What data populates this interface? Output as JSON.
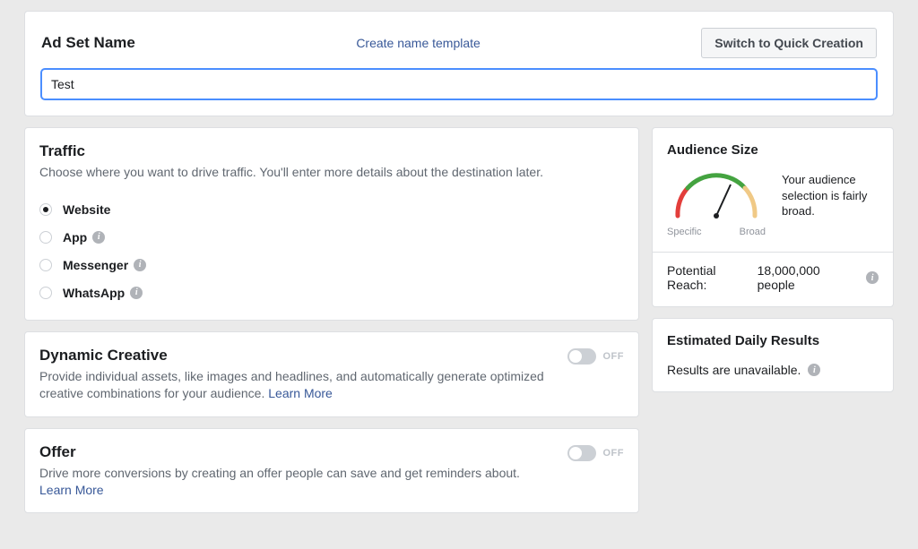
{
  "adset": {
    "title": "Ad Set Name",
    "template_link": "Create name template",
    "switch_button": "Switch to Quick Creation",
    "name_value": "Test"
  },
  "traffic": {
    "title": "Traffic",
    "subtitle": "Choose where you want to drive traffic. You'll enter more details about the destination later.",
    "options": [
      {
        "label": "Website",
        "info": false,
        "selected": true
      },
      {
        "label": "App",
        "info": true,
        "selected": false
      },
      {
        "label": "Messenger",
        "info": true,
        "selected": false
      },
      {
        "label": "WhatsApp",
        "info": true,
        "selected": false
      }
    ]
  },
  "dynamic": {
    "title": "Dynamic Creative",
    "desc": "Provide individual assets, like images and headlines, and automatically generate optimized creative combinations for your audience. ",
    "learn_more": "Learn More",
    "state": "OFF"
  },
  "offer": {
    "title": "Offer",
    "desc": "Drive more conversions by creating an offer people can save and get reminders about.",
    "learn_more": "Learn More",
    "state": "OFF"
  },
  "audience": {
    "title": "Audience Size",
    "gauge_specific": "Specific",
    "gauge_broad": "Broad",
    "desc": "Your audience selection is fairly broad.",
    "reach_label": "Potential Reach: ",
    "reach_value": "18,000,000 people"
  },
  "edr": {
    "title": "Estimated Daily Results",
    "message": "Results are unavailable."
  },
  "info_glyph": "i"
}
